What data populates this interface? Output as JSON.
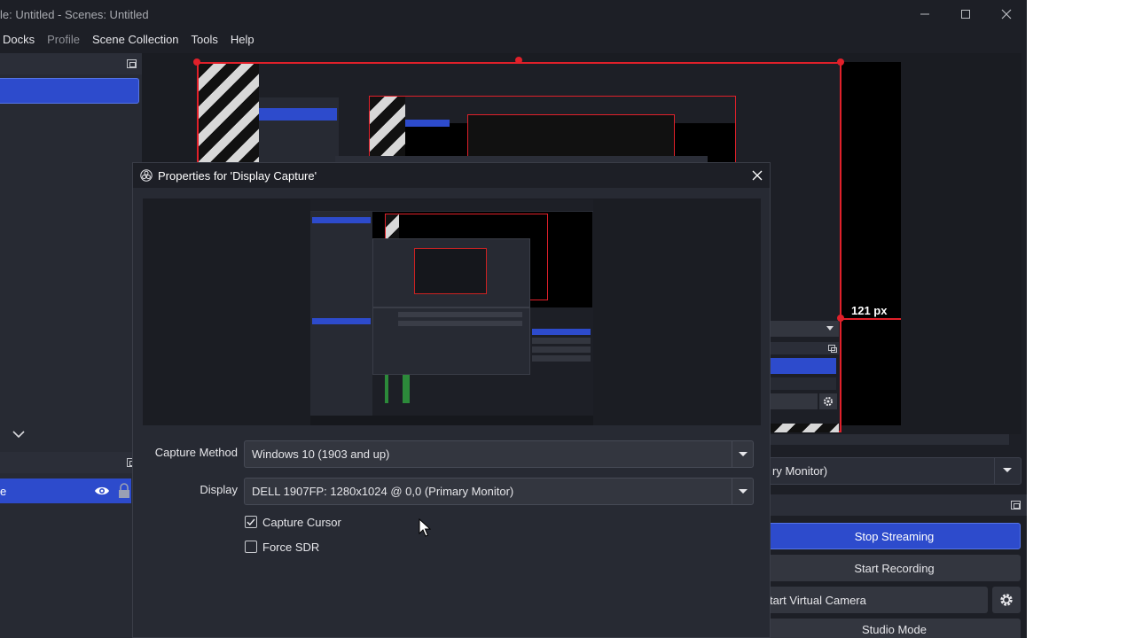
{
  "window": {
    "title": "le: Untitled - Scenes: Untitled",
    "controls": [
      "minimize-icon",
      "maximize-icon",
      "close-icon"
    ]
  },
  "menu": {
    "items": [
      "Docks",
      "Profile",
      "Scene Collection",
      "Tools",
      "Help"
    ]
  },
  "sources": {
    "selected_item_fragment": "e"
  },
  "preview": {
    "crop_label": "121 px"
  },
  "right_panel": {
    "display_select_fragment": "ry Monitor)",
    "buttons": {
      "stop_streaming": "Stop Streaming",
      "start_recording": "Start Recording",
      "start_virtual_camera": "tart Virtual Camera",
      "studio_mode": "Studio Mode"
    }
  },
  "dialog": {
    "title": "Properties for 'Display Capture'",
    "capture_method_label": "Capture Method",
    "capture_method_value": "Windows 10 (1903 and up)",
    "display_label": "Display",
    "display_value": "DELL 1907FP: 1280x1024 @ 0,0 (Primary Monitor)",
    "capture_cursor_label": "Capture Cursor",
    "capture_cursor_checked": true,
    "force_sdr_label": "Force SDR",
    "force_sdr_checked": false
  },
  "colors": {
    "accent": "#2d4bcc",
    "crop": "#e0202a",
    "background": "#1d1f26"
  }
}
